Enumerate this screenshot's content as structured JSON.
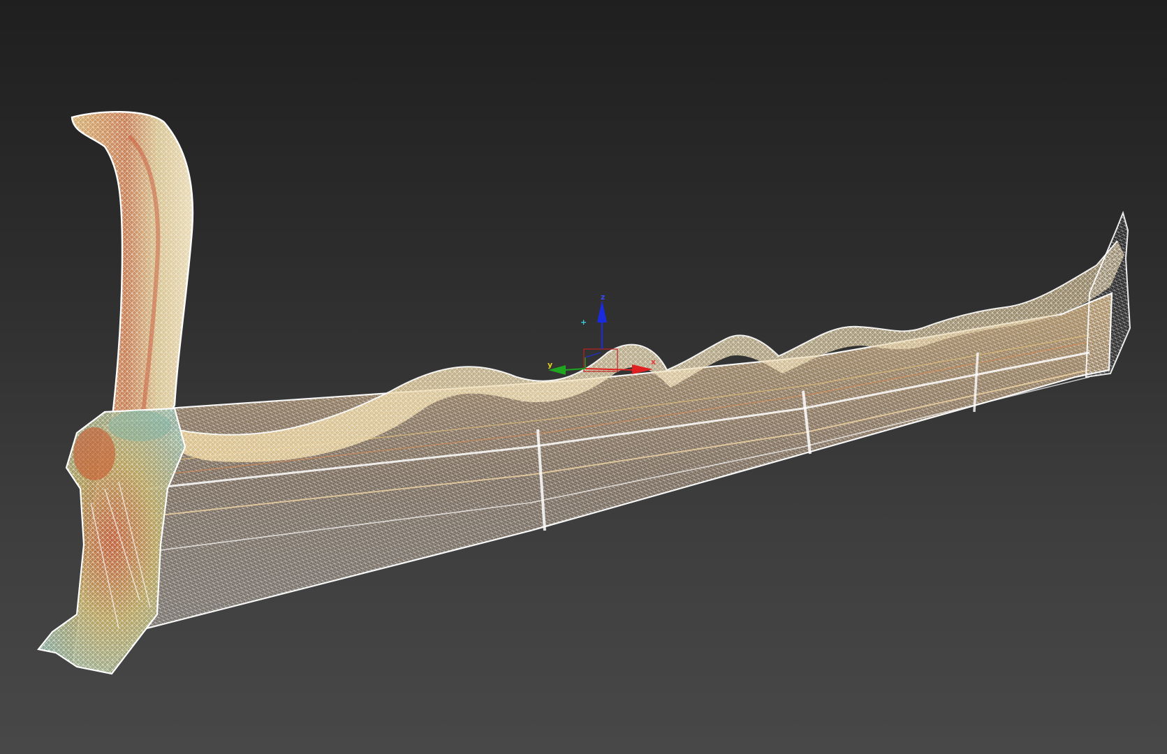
{
  "viewport": {
    "mode": "wireframe-perspective",
    "background_top": "#1f1f1f",
    "background_bottom": "#484848"
  },
  "model": {
    "name": "",
    "wire_color": "#fbfbf5",
    "tint_colors": [
      "#e8c98a",
      "#d89a5a",
      "#c8643a",
      "#9bb7a8",
      "#a9b25a"
    ]
  },
  "gizmo": {
    "x_label": "x",
    "y_label": "y",
    "z_label": "z",
    "x_color": "#e02020",
    "y_color": "#1fa51f",
    "z_color": "#1a2ae0",
    "pivot_marker": "+",
    "pivot_color": "#3ad0e0"
  }
}
